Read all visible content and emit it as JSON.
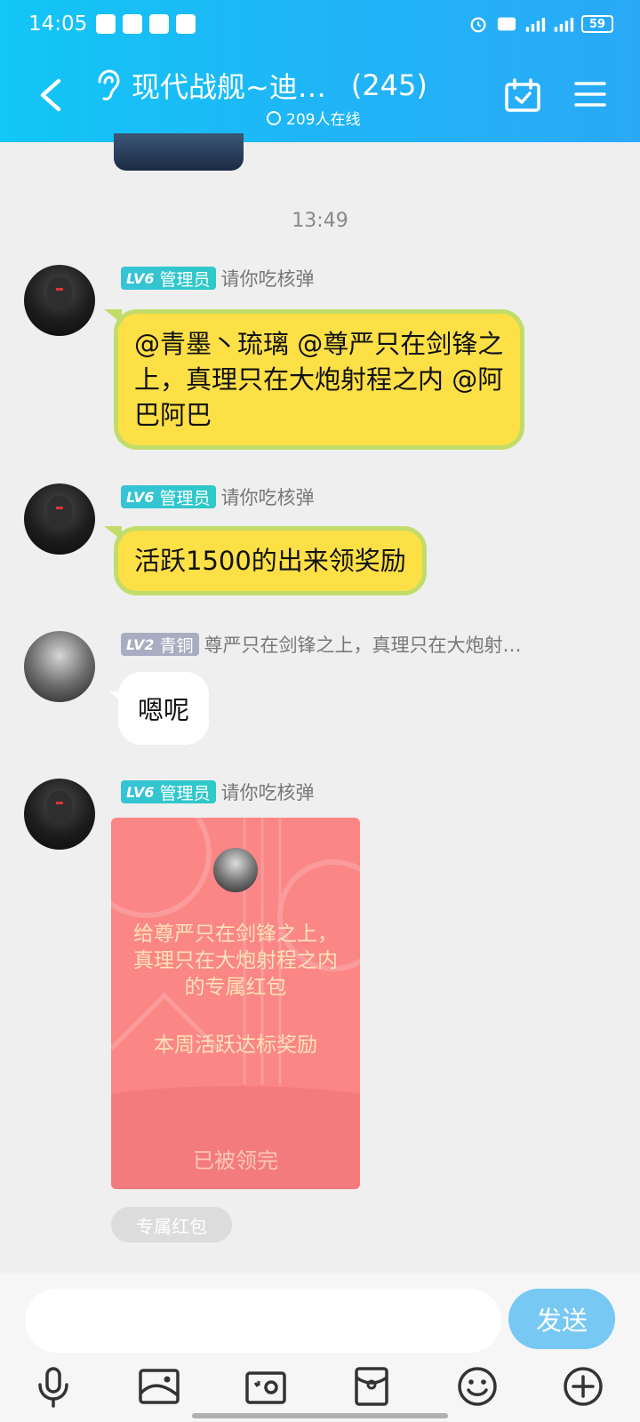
{
  "status_bar": {
    "time": "14:05",
    "battery": "59"
  },
  "header": {
    "title": "现代战舰~迪…",
    "member_count": "(245)",
    "online": "209人在线"
  },
  "chat": {
    "timestamp": "13:49",
    "messages": [
      {
        "badge_level": "LV6",
        "badge_role": "管理员",
        "sender": "请你吃核弹",
        "text": "@青墨丶琉璃 @尊严只在剑锋之上，真理只在大炮射程之内 @阿巴阿巴"
      },
      {
        "badge_level": "LV6",
        "badge_role": "管理员",
        "sender": "请你吃核弹",
        "text": "活跃1500的出来领奖励"
      },
      {
        "badge_level": "LV2",
        "badge_role": "青铜",
        "sender": "尊严只在剑锋之上，真理只在大炮射…",
        "text": "嗯呢"
      },
      {
        "badge_level": "LV6",
        "badge_role": "管理员",
        "sender": "请你吃核弹",
        "packet_text": "给尊严只在剑锋之上，真理只在大炮射程之内的专属红包",
        "packet_note": "本周活跃达标奖励",
        "packet_status": "已被领完",
        "packet_tag": "专属红包"
      }
    ]
  },
  "input_bar": {
    "send_label": "发送"
  },
  "colors": {
    "header": "#1fb5f7",
    "bubble": "#fde046",
    "bubble_border": "#c2dc6a",
    "packet": "#fb8686",
    "send": "#78c8f4"
  }
}
